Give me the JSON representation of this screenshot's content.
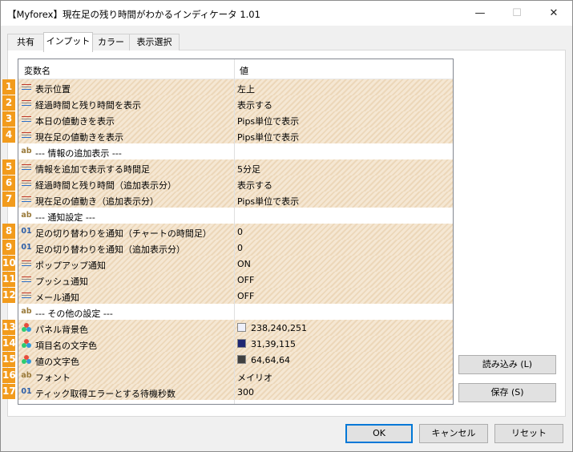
{
  "window": {
    "title": "【Myforex】現在足の残り時間がわかるインディケータ 1.01",
    "minimize_glyph": "—",
    "maximize_glyph": "☐",
    "close_glyph": "✕"
  },
  "tabs": [
    {
      "label": "共有",
      "active": false
    },
    {
      "label": "インプット",
      "active": true
    },
    {
      "label": "カラー",
      "active": false
    },
    {
      "label": "表示選択",
      "active": false
    }
  ],
  "grid": {
    "header_name": "変数名",
    "header_value": "値"
  },
  "rows": [
    {
      "badge": "1",
      "icon": "list-icon",
      "name": "表示位置",
      "value": "左上",
      "hatch": true
    },
    {
      "badge": "2",
      "icon": "list-icon",
      "name": "経過時間と残り時間を表示",
      "value": "表示する",
      "hatch": true
    },
    {
      "badge": "3",
      "icon": "list-icon",
      "name": "本日の値動きを表示",
      "value": "Pips単位で表示",
      "hatch": true
    },
    {
      "badge": "4",
      "icon": "list-icon",
      "name": "現在足の値動きを表示",
      "value": "Pips単位で表示",
      "hatch": true
    },
    {
      "badge": "",
      "icon": "text-icon",
      "name": "--- 情報の追加表示 ---",
      "value": "",
      "hatch": false
    },
    {
      "badge": "5",
      "icon": "list-icon",
      "name": "情報を追加で表示する時間足",
      "value": "5分足",
      "hatch": true
    },
    {
      "badge": "6",
      "icon": "list-icon",
      "name": "経過時間と残り時間（追加表示分）",
      "value": "表示する",
      "hatch": true
    },
    {
      "badge": "7",
      "icon": "list-icon",
      "name": "現在足の値動き（追加表示分）",
      "value": "Pips単位で表示",
      "hatch": true
    },
    {
      "badge": "",
      "icon": "text-icon",
      "name": "--- 通知設定 ---",
      "value": "",
      "hatch": false
    },
    {
      "badge": "8",
      "icon": "number-icon",
      "name": "足の切り替わりを通知（チャートの時間足）",
      "value": "0",
      "hatch": true
    },
    {
      "badge": "9",
      "icon": "number-icon",
      "name": "足の切り替わりを通知（追加表示分）",
      "value": "0",
      "hatch": true
    },
    {
      "badge": "10",
      "icon": "list-icon",
      "name": "ポップアップ通知",
      "value": "ON",
      "hatch": true
    },
    {
      "badge": "11",
      "icon": "list-icon",
      "name": "プッシュ通知",
      "value": "OFF",
      "hatch": true
    },
    {
      "badge": "12",
      "icon": "list-icon",
      "name": "メール通知",
      "value": "OFF",
      "hatch": true
    },
    {
      "badge": "",
      "icon": "text-icon",
      "name": "--- その他の設定 ---",
      "value": "",
      "hatch": false
    },
    {
      "badge": "13",
      "icon": "color-icon",
      "name": "パネル背景色",
      "value": "238,240,251",
      "swatch": "#eef0fb",
      "hatch": true
    },
    {
      "badge": "14",
      "icon": "color-icon",
      "name": "項目名の文字色",
      "value": "31,39,115",
      "swatch": "#1f2773",
      "hatch": true
    },
    {
      "badge": "15",
      "icon": "color-icon",
      "name": "値の文字色",
      "value": "64,64,64",
      "swatch": "#404040",
      "hatch": true
    },
    {
      "badge": "16",
      "icon": "text-icon",
      "name": "フォント",
      "value": "メイリオ",
      "hatch": true
    },
    {
      "badge": "17",
      "icon": "number-icon",
      "name": "ティック取得エラーとする待機秒数",
      "value": "300",
      "hatch": true
    }
  ],
  "icons": {
    "text_label": "ab",
    "number_label": "01"
  },
  "buttons": {
    "load": "読み込み (L)",
    "save": "保存 (S)",
    "ok": "OK",
    "cancel": "キャンセル",
    "reset": "リセット"
  },
  "colors": {
    "badge": "#f29b1c",
    "hatch_light": "#f5e7d3",
    "hatch_dark": "#ecd7b9",
    "ok_border": "#0078d7"
  }
}
